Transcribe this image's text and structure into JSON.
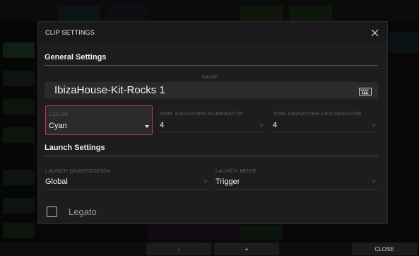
{
  "dialog": {
    "title": "CLIP SETTINGS",
    "close_icon": "close-icon"
  },
  "general": {
    "title": "General Settings",
    "name_label": "NAME",
    "name_value": "IbizaHouse-Kit-Rocks 1",
    "keyboard_icon": "keyboard-icon",
    "color_label": "COLOR",
    "color_value": "Cyan",
    "ts_num_label": "TIME SIGNATURE NUMERATOR",
    "ts_num_value": "4",
    "ts_den_label": "TIME SIGNATURE DENOMINATOR",
    "ts_den_value": "4"
  },
  "launch": {
    "title": "Launch Settings",
    "quant_label": "LAUNCH QUANTIZATION",
    "quant_value": "Global",
    "mode_label": "LAUNCH MODE",
    "mode_value": "Trigger",
    "legato_label": "Legato",
    "legato_checked": false
  },
  "bottom": {
    "minus_label": "-",
    "plus_label": "+",
    "close_label": "CLOSE"
  },
  "colors": {
    "accent_border": "#c8303f",
    "dialog_bg": "#1d1d1d"
  }
}
